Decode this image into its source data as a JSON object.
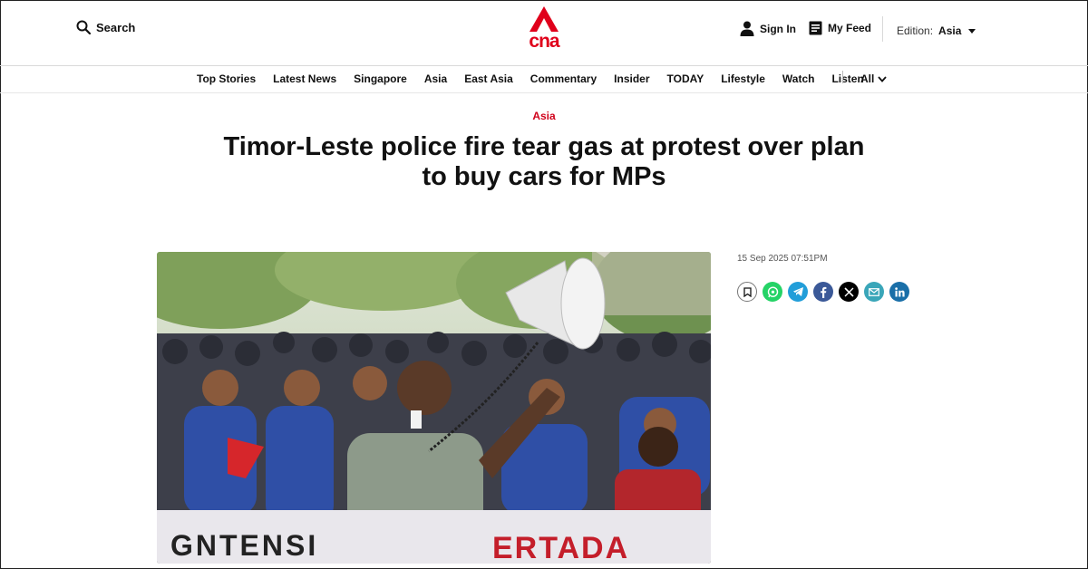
{
  "header": {
    "search_label": "Search",
    "logo_text": "cna",
    "signin_label": "Sign In",
    "myfeed_label": "My Feed",
    "edition_label": "Edition:",
    "edition_value": "Asia"
  },
  "nav": {
    "items": [
      "Top Stories",
      "Latest News",
      "Singapore",
      "Asia",
      "East Asia",
      "Commentary",
      "Insider",
      "TODAY",
      "Lifestyle",
      "Watch",
      "Listen"
    ],
    "all_label": "All"
  },
  "article": {
    "category": "Asia",
    "headline_line1": "Timor-Leste police fire tear gas at protest over plan",
    "headline_line2": "to buy cars for MPs",
    "timestamp": "15 Sep 2025 07:51PM",
    "banner_text_left": "GNTENSI",
    "banner_text_right": "ERTADA"
  },
  "share": {
    "icons": [
      "bookmark-icon",
      "whatsapp-icon",
      "telegram-icon",
      "facebook-icon",
      "x-icon",
      "email-icon",
      "linkedin-icon"
    ],
    "colors": {
      "whatsapp": "#25d366",
      "telegram": "#229ed9",
      "facebook": "#3b5998",
      "x": "#000000",
      "email": "#3aa6b9",
      "linkedin": "#1a6fa8"
    }
  },
  "colors": {
    "brand": "#e0001b",
    "category": "#d0021b"
  }
}
